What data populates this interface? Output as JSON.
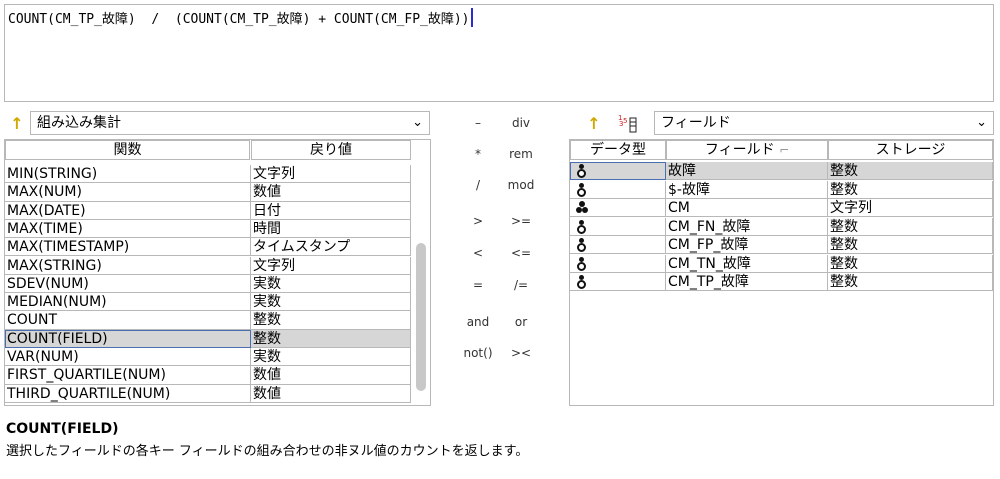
{
  "expression": "COUNT(CM_TP_故障)  /  (COUNT(CM_TP_故障) + COUNT(CM_FP_故障))",
  "functions_panel": {
    "category_selected": "組み込み集計",
    "headers": {
      "function": "関数",
      "return": "戻り値"
    },
    "rows": [
      {
        "func": "MIN(STRING)",
        "ret": "文字列"
      },
      {
        "func": "MAX(NUM)",
        "ret": "数値"
      },
      {
        "func": "MAX(DATE)",
        "ret": "日付"
      },
      {
        "func": "MAX(TIME)",
        "ret": "時間"
      },
      {
        "func": "MAX(TIMESTAMP)",
        "ret": "タイムスタンプ"
      },
      {
        "func": "MAX(STRING)",
        "ret": "文字列"
      },
      {
        "func": "SDEV(NUM)",
        "ret": "実数"
      },
      {
        "func": "MEDIAN(NUM)",
        "ret": "実数"
      },
      {
        "func": "COUNT",
        "ret": "整数"
      },
      {
        "func": "COUNT(FIELD)",
        "ret": "整数"
      },
      {
        "func": "VAR(NUM)",
        "ret": "実数"
      },
      {
        "func": "FIRST_QUARTILE(NUM)",
        "ret": "数値"
      },
      {
        "func": "THIRD_QUARTILE(NUM)",
        "ret": "数値"
      }
    ]
  },
  "operators": [
    [
      "–",
      "div"
    ],
    [
      "*",
      "rem"
    ],
    [
      "/",
      "mod"
    ],
    [
      ">",
      ">="
    ],
    [
      "<",
      "<="
    ],
    [
      "=",
      "/="
    ],
    [
      "and",
      "or"
    ],
    [
      "not()",
      "><"
    ]
  ],
  "fields_panel": {
    "category_selected": "フィールド",
    "headers": {
      "type": "データ型",
      "field": "フィールド",
      "storage": "ストレージ"
    },
    "rows": [
      {
        "icon": "ordinal-icon",
        "field": "故障",
        "storage": "整数"
      },
      {
        "icon": "ordinal-icon",
        "field": "$-故障",
        "storage": "整数"
      },
      {
        "icon": "nominal-icon",
        "field": "CM",
        "storage": "文字列"
      },
      {
        "icon": "ordinal-icon",
        "field": "CM_FN_故障",
        "storage": "整数"
      },
      {
        "icon": "ordinal-icon",
        "field": "CM_FP_故障",
        "storage": "整数"
      },
      {
        "icon": "ordinal-icon",
        "field": "CM_TN_故障",
        "storage": "整数"
      },
      {
        "icon": "ordinal-icon",
        "field": "CM_TP_故障",
        "storage": "整数"
      }
    ]
  },
  "description": {
    "title": "COUNT(FIELD)",
    "text": "選択したフィールドの各キー フィールドの組み合わせの非ヌル値のカウントを返します。"
  },
  "icons": {
    "up": "↑",
    "chevron": "⌄",
    "sort_glyph": "⌐"
  }
}
